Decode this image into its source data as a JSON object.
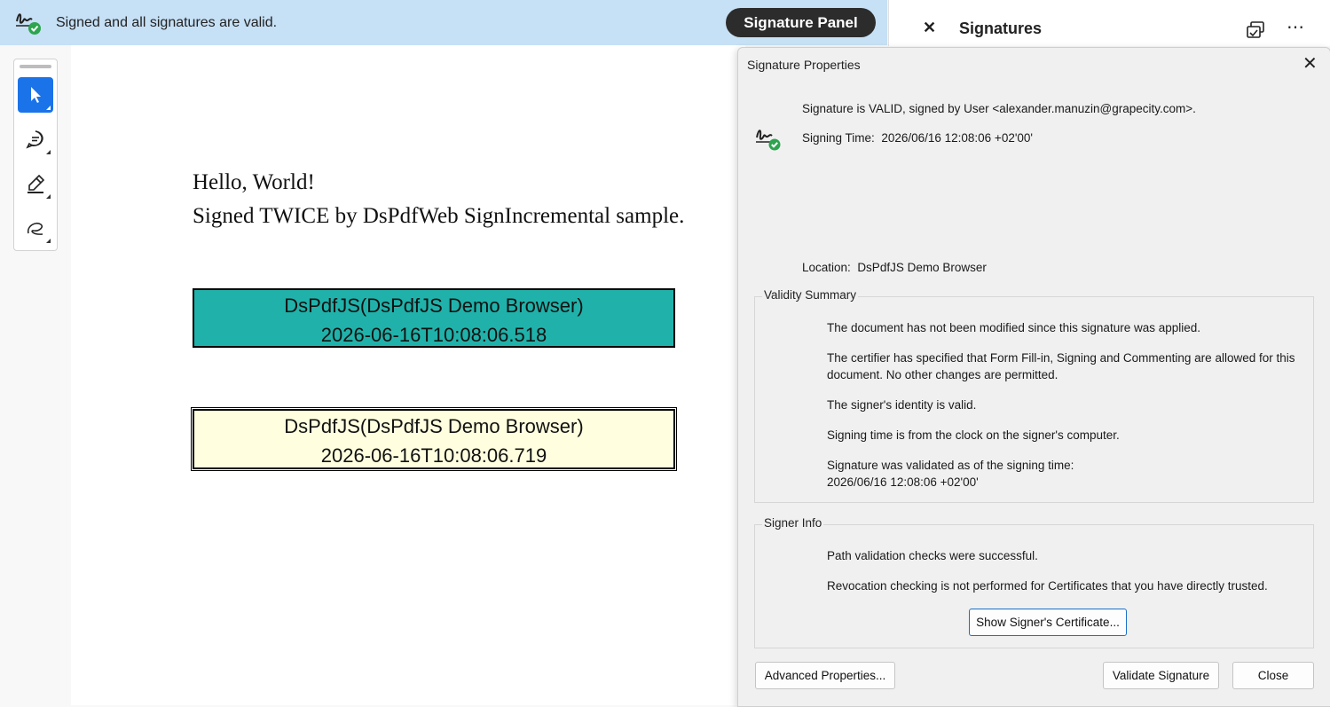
{
  "banner": {
    "status_text": "Signed and all signatures are valid.",
    "panel_button": "Signature Panel"
  },
  "right_panel": {
    "close": "✕",
    "title": "Signatures",
    "more": "⋯"
  },
  "document": {
    "line1": "Hello, World!",
    "line2": "Signed TWICE by DsPdfWeb SignIncremental sample.",
    "signature1": {
      "name": "DsPdfJS(DsPdfJS Demo Browser)",
      "timestamp": "2026-06-16T10:08:06.518"
    },
    "signature2": {
      "name": "DsPdfJS(DsPdfJS Demo Browser)",
      "timestamp": "2026-06-16T10:08:06.719"
    }
  },
  "dialog": {
    "title": "Signature Properties",
    "close": "✕",
    "valid_line": "Signature is VALID, signed by User <alexander.manuzin@grapecity.com>.",
    "signing_time_label": "Signing Time:",
    "signing_time_value": "2026/06/16 12:08:06 +02'00'",
    "location_label": "Location:",
    "location_value": "DsPdfJS Demo Browser",
    "validity_summary": {
      "label": "Validity Summary",
      "items": [
        "The document has not been modified since this signature was applied.",
        "The certifier has specified that Form Fill-in, Signing and Commenting are allowed for this document. No other changes are permitted.",
        "The signer's identity is valid.",
        "Signing time is from the clock on the signer's computer.",
        "Signature was validated as of the signing time:",
        "2026/06/16 12:08:06 +02'00'"
      ]
    },
    "signer_info": {
      "label": "Signer Info",
      "items": [
        "Path validation checks were successful.",
        "Revocation checking is not performed for Certificates that you have directly trusted."
      ],
      "show_cert_button": "Show Signer's Certificate..."
    },
    "buttons": {
      "advanced": "Advanced Properties...",
      "validate": "Validate Signature",
      "close": "Close"
    }
  },
  "colors": {
    "banner_bg": "#c6e0f5",
    "active_tool": "#1a73e8",
    "sig1_fill": "#20b2aa",
    "sig2_fill": "#ffffe0",
    "valid_check": "#2da44e"
  }
}
